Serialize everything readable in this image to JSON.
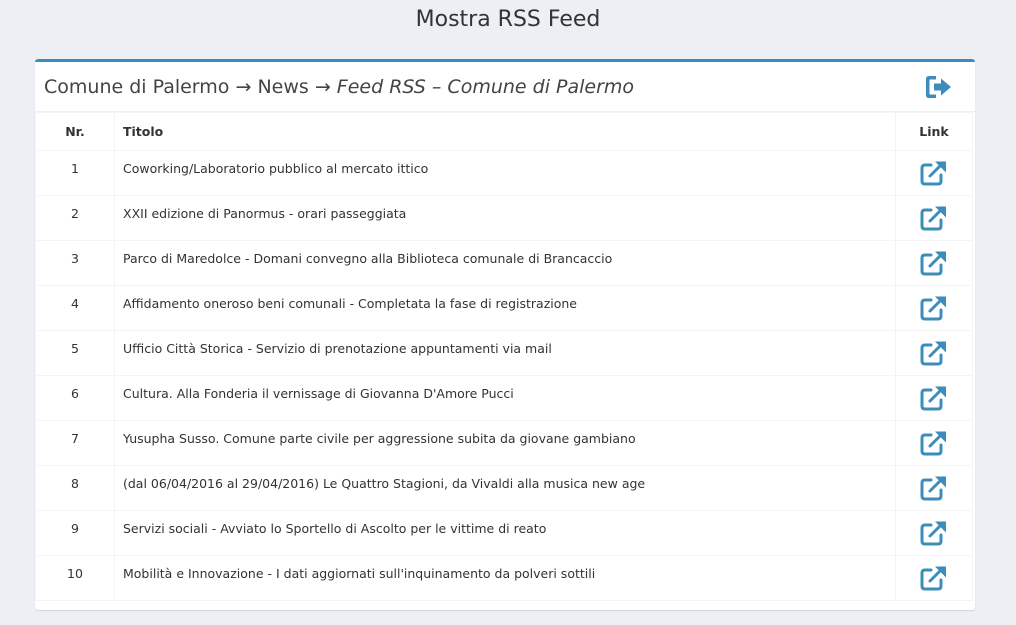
{
  "page": {
    "title": "Mostra RSS Feed"
  },
  "breadcrumb": {
    "root": "Comune di Palermo",
    "separator": "→",
    "section": "News",
    "feed": "Feed RSS – Comune di Palermo"
  },
  "icons": {
    "exit": "sign-out-icon",
    "link": "external-link-icon"
  },
  "colors": {
    "accent": "#3c8dbc",
    "background": "#ecf0f5"
  },
  "table": {
    "headers": {
      "nr": "Nr.",
      "title": "Titolo",
      "link": "Link"
    },
    "rows": [
      {
        "nr": "1",
        "title": "Coworking/Laboratorio pubblico al mercato ittico"
      },
      {
        "nr": "2",
        "title": "XXII edizione di Panormus - orari passeggiata"
      },
      {
        "nr": "3",
        "title": "Parco di Maredolce - Domani convegno alla Biblioteca comunale di Brancaccio"
      },
      {
        "nr": "4",
        "title": "Affidamento oneroso beni comunali - Completata la fase di registrazione"
      },
      {
        "nr": "5",
        "title": "Ufficio Città Storica - Servizio di prenotazione appuntamenti via mail"
      },
      {
        "nr": "6",
        "title": "Cultura. Alla Fonderia il vernissage di Giovanna D'Amore Pucci"
      },
      {
        "nr": "7",
        "title": "Yusupha Susso. Comune parte civile per aggressione subita da giovane gambiano"
      },
      {
        "nr": "8",
        "title": "(dal 06/04/2016 al 29/04/2016) Le Quattro Stagioni, da Vivaldi alla musica new age"
      },
      {
        "nr": "9",
        "title": "Servizi sociali - Avviato lo Sportello di Ascolto per le vittime di reato"
      },
      {
        "nr": "10",
        "title": "Mobilità e Innovazione - I dati aggiornati sull'inquinamento da polveri sottili"
      }
    ]
  }
}
